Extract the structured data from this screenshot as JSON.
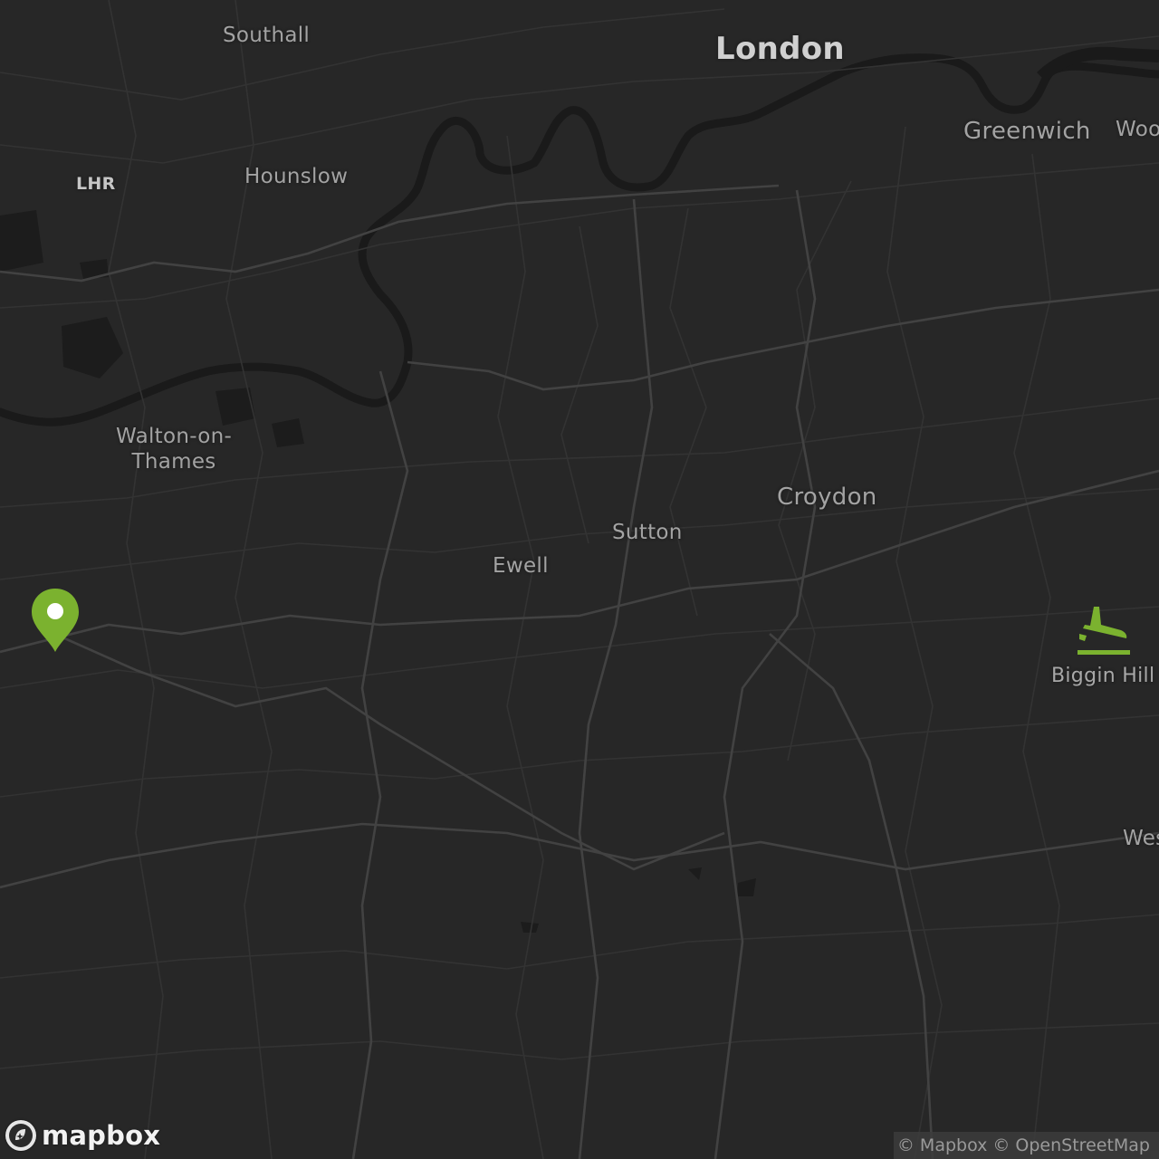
{
  "map": {
    "theme": "dark",
    "background_color": "#272727",
    "road_color": "#3c3c3c",
    "water_color": "#1b1b1b",
    "accent_color": "#7bb22f"
  },
  "places": {
    "london": "London",
    "southall": "Southall",
    "greenwich": "Greenwich",
    "woolwich_partial": "Woo",
    "lhr": "LHR",
    "hounslow": "Hounslow",
    "walton_line1": "Walton-on-",
    "walton_line2": "Thames",
    "croydon": "Croydon",
    "sutton": "Sutton",
    "ewell": "Ewell",
    "west_partial": "Wes"
  },
  "marker": {
    "icon": "map-pin-icon",
    "color": "#7bb22f"
  },
  "airport": {
    "icon": "airplane-landing-icon",
    "label": "Biggin Hill",
    "color": "#7bb22f"
  },
  "logo": {
    "icon": "mapbox-logo-icon",
    "text": "mapbox"
  },
  "attribution": {
    "mapbox": "© Mapbox",
    "osm": "© OpenStreetMap"
  }
}
